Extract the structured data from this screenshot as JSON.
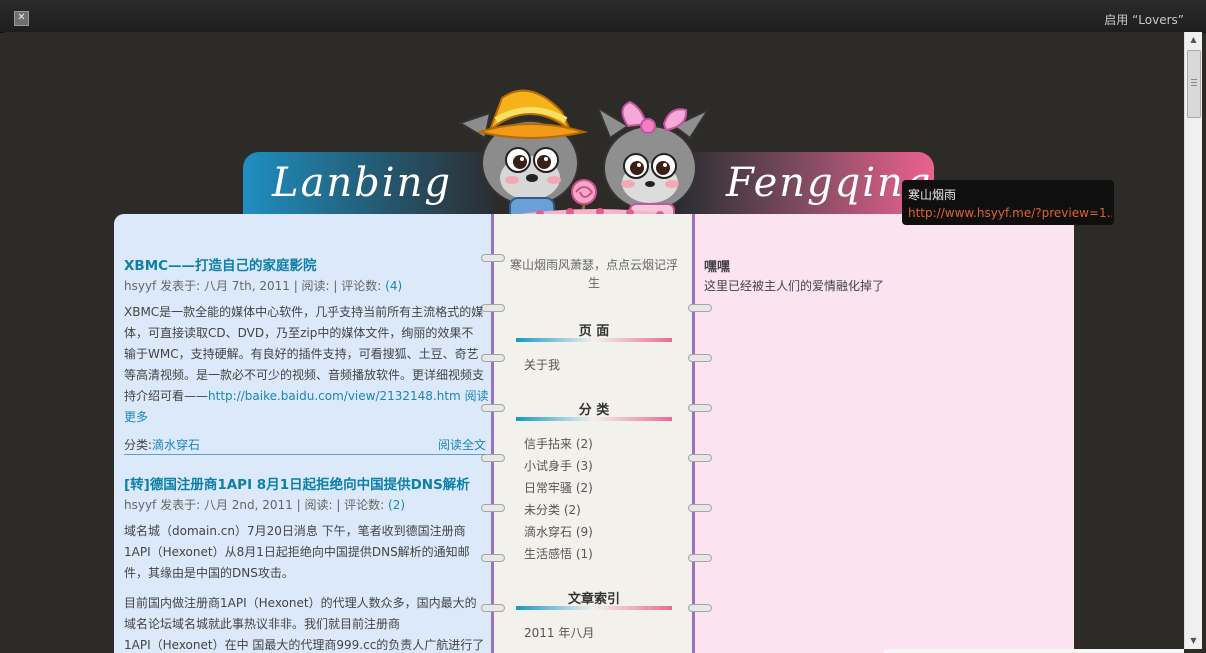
{
  "topbar": {
    "close_icon": "close-icon",
    "activate_label": "启用 “Lovers”"
  },
  "banner": {
    "left_text": "Lanbing",
    "right_text": "Fengqing"
  },
  "posts": [
    {
      "title": "XBMC——打造自己的家庭影院",
      "meta_prefix": "hsyyf 发表于: 八月 7th, 2011 | 阅读: | 评论数: ",
      "comments": "(4)",
      "body_lines": [
        "XBMC是一款全能的媒体中心软件，几乎支持当前所有主流格式的媒",
        "体，可直接读取CD、DVD，乃至zip中的媒体文件，绚丽的效果不",
        "输于WMC，支持硬解。有良好的插件支持，可看搜狐、土豆、奇艺",
        "等高清视频。是一款必不可少的视频、音频播放软件。更详细视频支"
      ],
      "body_tail": "持介绍可看——",
      "link": "http://baike.baidu.com/view/2132148.htm",
      "read_more_a": "阅读",
      "read_more_b": "更多",
      "category_label": "分类:",
      "category": "滴水穿石",
      "read_all": "阅读全文"
    },
    {
      "title": "[转]德国注册商1API 8月1日起拒绝向中国提供DNS解析",
      "meta_prefix": "hsyyf 发表于: 八月 2nd, 2011 | 阅读: | 评论数: ",
      "comments": "(2)",
      "para1": [
        "域名城（domain.cn）7月20日消息    下午，笔者收到德国注册商",
        "1API（Hexonet）从8月1日起拒绝向中国提供DNS解析的通知邮",
        "件，其缘由是中国的DNS攻击。"
      ],
      "para2": [
        "目前国内做注册商1API（Hexonet）的代理人数众多，国内最大的",
        "域名论坛域名城就此事热议非非。我们就目前注册商",
        "1API（Hexonet）在中 国最大的代理商999.cc的负责人广航进行了"
      ]
    }
  ],
  "sidebar": {
    "tagline": "寒山烟雨风萧瑟，点点云烟记浮生",
    "pages_heading": "页 面",
    "pages": [
      "关于我"
    ],
    "categories_heading": "分 类",
    "categories": [
      "信手拈来 (2)",
      "小试身手 (3)",
      "日常牢骚 (2)",
      "未分类 (2)",
      "滴水穿石 (9)",
      "生活感悟 (1)"
    ],
    "archive_heading": "文章索引",
    "archive": [
      "2011 年八月"
    ]
  },
  "right": {
    "title": "嘿嘿",
    "body": "这里已经被主人们的爱情融化掉了"
  },
  "tooltip": {
    "title": "寒山烟雨",
    "url": "http://www.hsyyf.me/?preview=1..."
  },
  "colors": {
    "accent_blue": "#1a86b7",
    "accent_pink": "#ec6190",
    "purple_border": "#9b72c2"
  }
}
